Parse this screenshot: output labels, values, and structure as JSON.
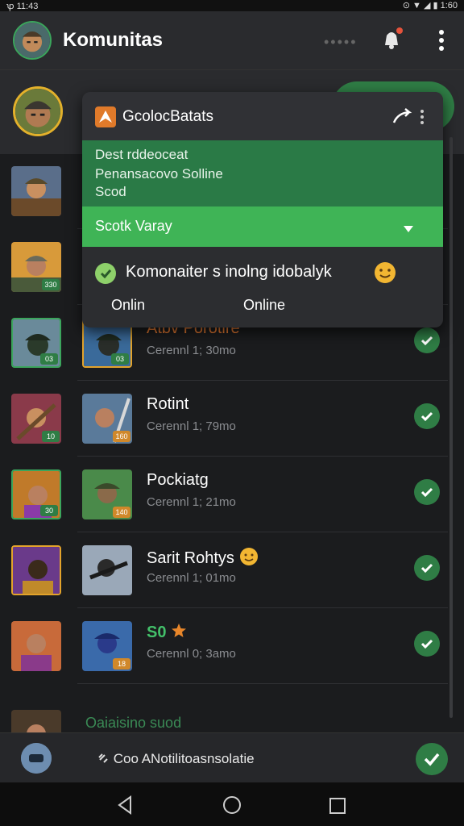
{
  "status": {
    "left": "ꝕ 11:43",
    "right": "⊙ ▼ ◢ ▮ 1:60"
  },
  "appbar": {
    "title": "Komunitas",
    "dots": "•••••"
  },
  "popup": {
    "title": "GcolocBatats",
    "lines": [
      "Dest rddeoceat",
      "Penansacovo Solline",
      "Scod"
    ],
    "select_value": "Scotk Varay",
    "message": "Komonaiter s inolng idobalyk",
    "status_left": "Onlin",
    "status_right": "Online"
  },
  "rows": [
    {
      "name": "",
      "sub": "",
      "badge_left": "",
      "badge_mid": ""
    },
    {
      "name": "",
      "sub": "",
      "badge_left": "330",
      "badge_mid": ""
    },
    {
      "name": "Atbv Porotire",
      "sub": "Cerennl 1; 30mo",
      "badge_left": "03",
      "badge_mid": "03"
    },
    {
      "name": "Rotint",
      "sub": "Cerennl 1; 79mo",
      "badge_left": "10",
      "badge_mid": "160"
    },
    {
      "name": "Pockiatg",
      "sub": "Cerennl 1; 21mo",
      "badge_left": "30",
      "badge_mid": "140"
    },
    {
      "name": "Sarit Rohtys",
      "sub": "Cerennl 1; 01mo",
      "badge_left": "",
      "badge_mid": ""
    },
    {
      "name": "S0",
      "sub": "Cerennl 0; 3amo",
      "badge_left": "",
      "badge_mid": "18"
    }
  ],
  "partial": {
    "text": "Oaiaisino suod"
  },
  "bottombar": {
    "text": "Coo ANotilitoasnsolatie"
  }
}
